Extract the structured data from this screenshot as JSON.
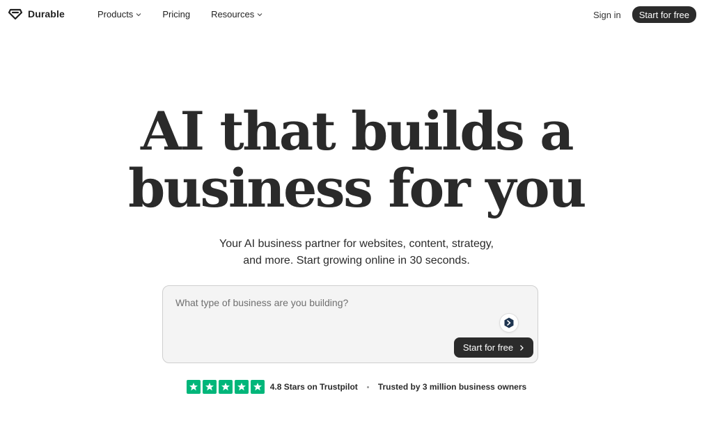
{
  "brand": {
    "name": "Durable",
    "logo_icon": "diamond-logo-icon"
  },
  "nav": {
    "items": [
      {
        "label": "Products",
        "has_dropdown": true
      },
      {
        "label": "Pricing",
        "has_dropdown": false
      },
      {
        "label": "Resources",
        "has_dropdown": true
      }
    ],
    "sign_in": "Sign in",
    "cta": "Start for free"
  },
  "hero": {
    "title_line1": "AI that builds a",
    "title_line2": "business for you",
    "subtitle_line1": "Your AI business partner for websites, content, strategy,",
    "subtitle_line2": "and more. Start growing online in 30 seconds."
  },
  "prompt": {
    "placeholder": "What type of business are you building?",
    "value": "",
    "assistant_icon": "assistant-badge-icon",
    "submit_label": "Start for free"
  },
  "trust": {
    "stars": 5,
    "rating_text": "4.8 Stars on Trustpilot",
    "trusted_text": "Trusted by 3 million business owners"
  },
  "colors": {
    "dark_button": "#2b2b2b",
    "trustpilot_green": "#00b67a",
    "prompt_bg": "#f4f4f4"
  }
}
